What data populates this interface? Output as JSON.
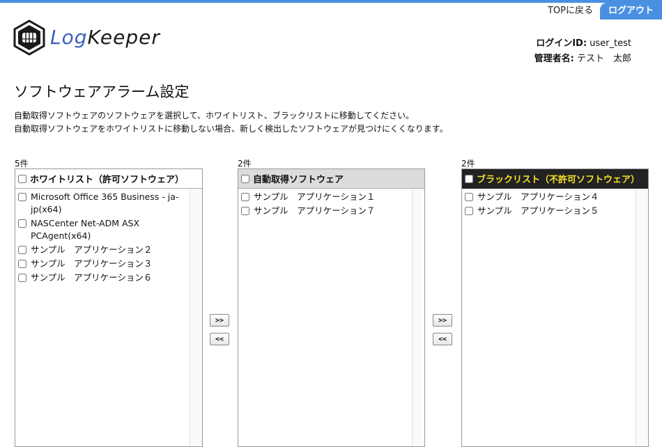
{
  "header": {
    "top_link": "TOPに戻る",
    "logout": "ログアウト",
    "logo_part1": "Log",
    "logo_part2": "Keeper",
    "login_id_label": "ログインID:",
    "login_id": "user_test",
    "admin_label": "管理者名:",
    "admin_name": "テスト　太郎"
  },
  "page": {
    "title": "ソフトウェアアラーム設定",
    "desc_line1": "自動取得ソフトウェアのソフトウェアを選択して、ホワイトリスト、ブラックリストに移動してください。",
    "desc_line2": "自動取得ソフトウェアをホワイトリストに移動しない場合、新しく検出したソフトウェアが見つけにくくなります。"
  },
  "whitelist": {
    "count": "5件",
    "title": "ホワイトリスト（許可ソフトウェア）",
    "items": [
      "Microsoft Office 365 Business - ja-jp(x64)",
      "NASCenter Net-ADM ASX PCAgent(x64)",
      "サンプル　アプリケーション２",
      "サンプル　アプリケーション３",
      "サンプル　アプリケーション６"
    ]
  },
  "auto": {
    "count": "2件",
    "title": "自動取得ソフトウェア",
    "items": [
      "サンプル　アプリケーション１",
      "サンプル　アプリケーション７"
    ]
  },
  "blacklist": {
    "count": "2件",
    "title": "ブラックリスト（不許可ソフトウェア）",
    "items": [
      "サンプル　アプリケーション４",
      "サンプル　アプリケーション５"
    ]
  },
  "buttons": {
    "move_right": ">>",
    "move_left": "<<"
  },
  "colors": {
    "accent": "#4a90e2",
    "blacklist_header_bg": "#222222",
    "blacklist_header_text": "#f5e12a",
    "auto_header_bg": "#dcdcdc"
  }
}
